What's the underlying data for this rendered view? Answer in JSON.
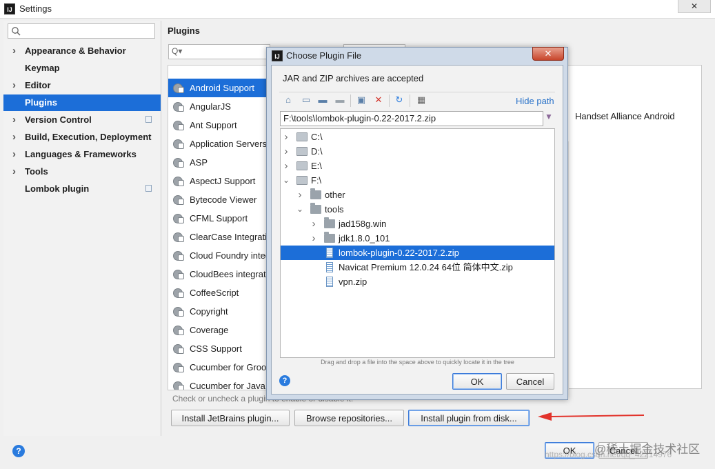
{
  "window": {
    "title": "Settings",
    "close_glyph": "✕"
  },
  "left_panel": {
    "search_placeholder": "",
    "items": [
      {
        "label": "Appearance & Behavior",
        "expandable": true
      },
      {
        "label": "Keymap",
        "expandable": false
      },
      {
        "label": "Editor",
        "expandable": true
      },
      {
        "label": "Plugins",
        "expandable": false,
        "selected": true
      },
      {
        "label": "Version Control",
        "expandable": true
      },
      {
        "label": "Build, Execution, Deployment",
        "expandable": true
      },
      {
        "label": "Languages & Frameworks",
        "expandable": true
      },
      {
        "label": "Tools",
        "expandable": true
      },
      {
        "label": "Lombok plugin",
        "expandable": false
      }
    ]
  },
  "plugins": {
    "title": "Plugins",
    "search_glyph": "Q▾",
    "list": [
      "Android Support",
      "AngularJS",
      "Ant Support",
      "Application Servers",
      "ASP",
      "AspectJ Support",
      "Bytecode Viewer",
      "CFML Support",
      "ClearCase Integratio",
      "Cloud Foundry integ",
      "CloudBees integratio",
      "CoffeeScript",
      "Copyright",
      "Coverage",
      "CSS Support",
      "Cucumber for Groov",
      "Cucumber for Java"
    ],
    "selected_index": 0,
    "detail_text": "Handset Alliance Android",
    "hint": "Check or uncheck a plugin to enable or disable it.",
    "buttons": {
      "install_jetbrains": "Install JetBrains plugin...",
      "browse": "Browse repositories...",
      "install_disk": "Install plugin from disk..."
    }
  },
  "footer": {
    "ok": "OK",
    "cancel": "Cancel",
    "help": "?"
  },
  "watermark": {
    "line1": "@稀土掘金技术社区",
    "line2": "https://blog.csdn.net/qq_42214976"
  },
  "dialog": {
    "title": "Choose Plugin File",
    "close_glyph": "✕",
    "description": "JAR and ZIP archives are accepted",
    "hide_path": "Hide path",
    "path": "F:\\tools\\lombok-plugin-0.22-2017.2.zip",
    "tree": [
      {
        "name": "C:\\",
        "depth": 0,
        "toggle": "›",
        "icon": "drive"
      },
      {
        "name": "D:\\",
        "depth": 0,
        "toggle": "›",
        "icon": "drive"
      },
      {
        "name": "E:\\",
        "depth": 0,
        "toggle": "›",
        "icon": "drive"
      },
      {
        "name": "F:\\",
        "depth": 0,
        "toggle": "⌄",
        "icon": "drive"
      },
      {
        "name": "other",
        "depth": 1,
        "toggle": "›",
        "icon": "folder"
      },
      {
        "name": "tools",
        "depth": 1,
        "toggle": "⌄",
        "icon": "folder"
      },
      {
        "name": "jad158g.win",
        "depth": 2,
        "toggle": "›",
        "icon": "folder"
      },
      {
        "name": "jdk1.8.0_101",
        "depth": 2,
        "toggle": "›",
        "icon": "folder"
      },
      {
        "name": "lombok-plugin-0.22-2017.2.zip",
        "depth": 2,
        "toggle": "",
        "icon": "zip",
        "selected": true
      },
      {
        "name": "Navicat Premium 12.0.24 64位 简体中文.zip",
        "depth": 2,
        "toggle": "",
        "icon": "zip"
      },
      {
        "name": "vpn.zip",
        "depth": 2,
        "toggle": "",
        "icon": "zip"
      }
    ],
    "drag_hint": "Drag and drop a file into the space above to quickly locate it in the tree",
    "ok": "OK",
    "cancel": "Cancel",
    "help": "?"
  },
  "colors": {
    "selection": "#1c6ed8",
    "link": "#2670c8",
    "arrow": "#e2332b"
  }
}
